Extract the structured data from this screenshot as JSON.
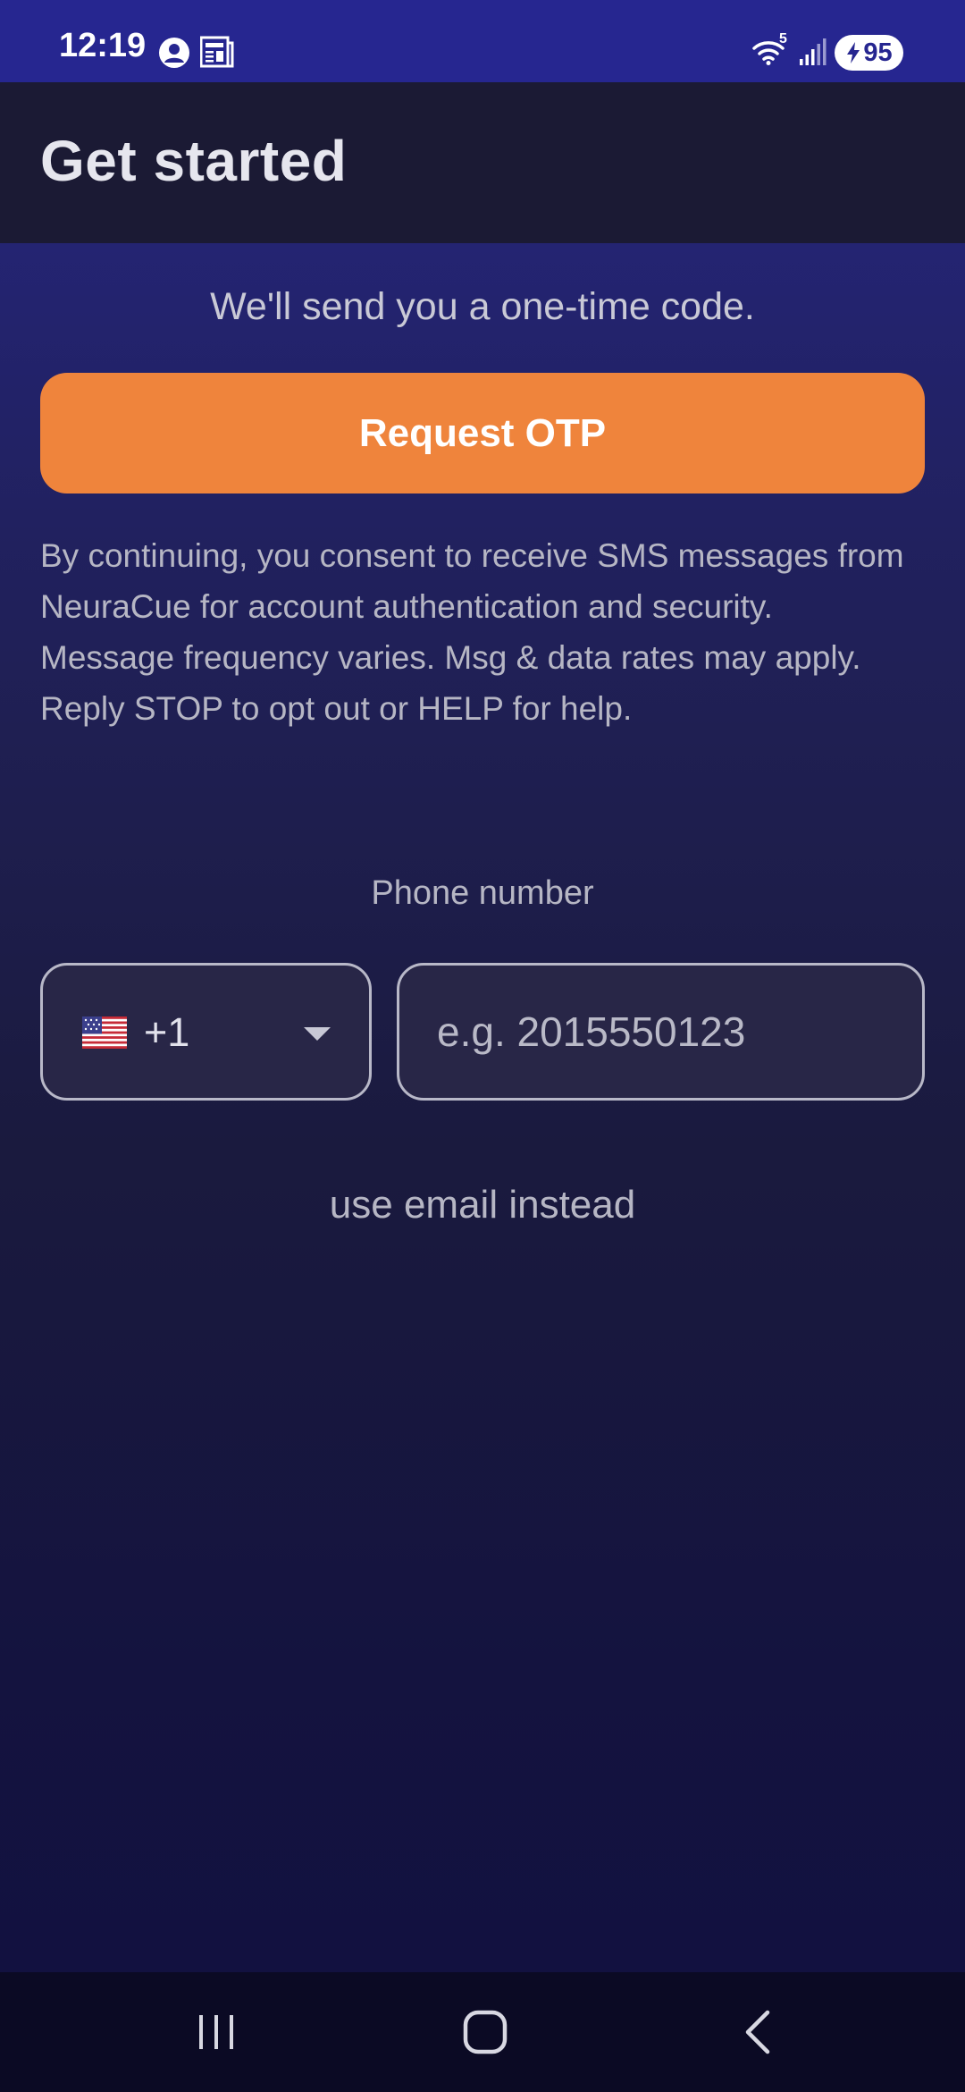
{
  "status_bar": {
    "time": "12:19",
    "battery_level": "95",
    "network_label": "5",
    "icons": [
      "account-circle-icon",
      "news-icon",
      "wifi-icon",
      "signal-icon",
      "battery-charging-icon"
    ]
  },
  "header": {
    "title": "Get started"
  },
  "main": {
    "subtitle": "We'll send you a one-time code.",
    "request_button_label": "Request OTP",
    "consent_lines": [
      "By continuing, you consent to receive SMS messages from NeuraCue for account authentication and security.",
      "Message frequency varies. Msg & data rates may apply.",
      "Reply STOP to opt out or HELP for help."
    ],
    "phone_label": "Phone number",
    "country": {
      "flag": "🇺🇸",
      "code": "+1"
    },
    "phone_input": {
      "value": "",
      "placeholder": "e.g. 2015550123"
    },
    "email_link": "use email instead"
  },
  "nav_bar": {
    "buttons": [
      "recent-apps-icon",
      "home-icon",
      "back-icon"
    ]
  },
  "colors": {
    "accent": "#ef843c",
    "status_bar": "#262690",
    "app_bar": "#1b1a34",
    "nav_bar": "#0b0a24"
  }
}
